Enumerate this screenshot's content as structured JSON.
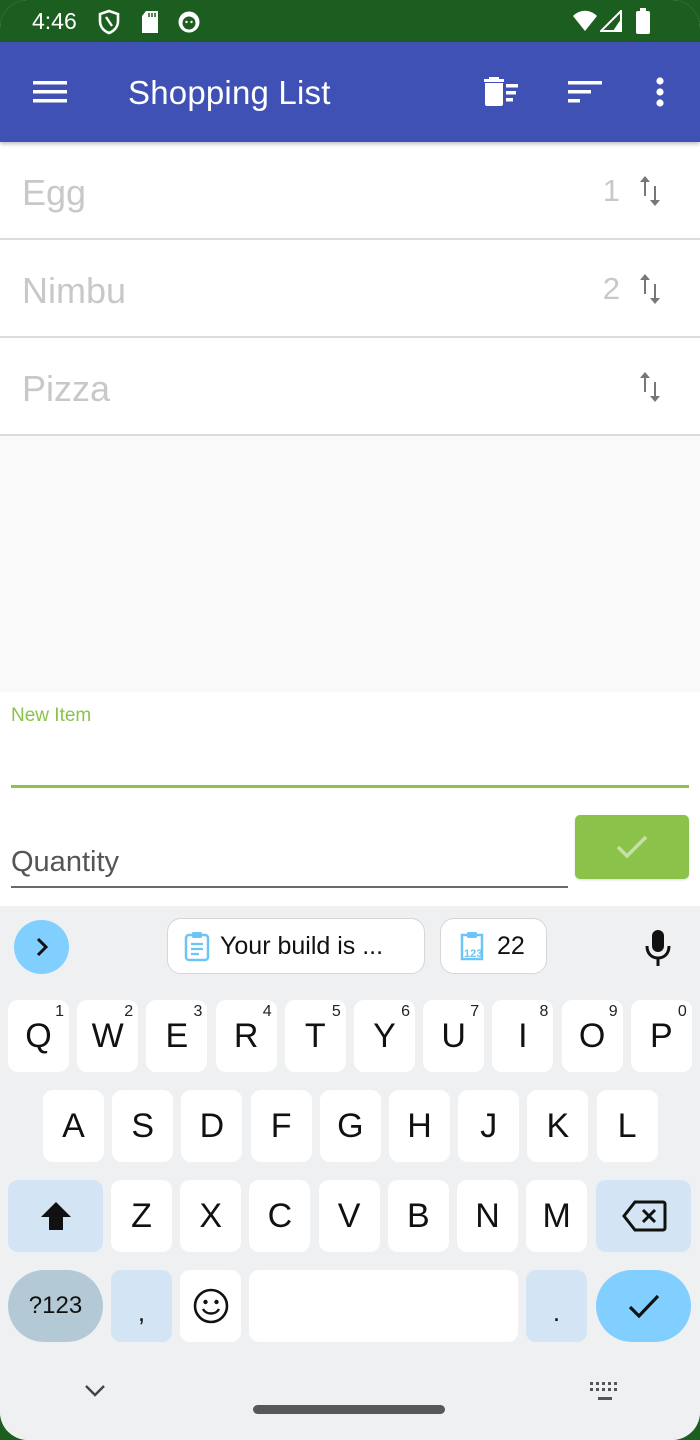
{
  "status_bar": {
    "time": "4:46",
    "left_icons": [
      "shield-icon",
      "sd-card-icon",
      "cat-face-icon"
    ],
    "right_icons": [
      "wifi-icon",
      "cell-signal-icon",
      "battery-icon"
    ]
  },
  "app_bar": {
    "title": "Shopping List",
    "menu_icon": "hamburger-menu-icon",
    "actions": [
      "delete-checked-icon",
      "sort-icon",
      "more-options-icon"
    ],
    "color": "#3f51b5"
  },
  "list": {
    "items": [
      {
        "name": "Egg",
        "quantity": "1"
      },
      {
        "name": "Nimbu",
        "quantity": "2"
      },
      {
        "name": "Pizza",
        "quantity": ""
      }
    ]
  },
  "entry": {
    "new_item_label": "New Item",
    "new_item_value": "",
    "quantity_placeholder": "Quantity",
    "quantity_value": "",
    "accent_color": "#8bc34a"
  },
  "keyboard": {
    "suggestions": [
      {
        "icon": "clipboard-icon",
        "text": "Your build is ..."
      },
      {
        "icon": "clipboard-number-icon",
        "text": "22"
      }
    ],
    "row1": [
      {
        "key": "Q",
        "hint": "1"
      },
      {
        "key": "W",
        "hint": "2"
      },
      {
        "key": "E",
        "hint": "3"
      },
      {
        "key": "R",
        "hint": "4"
      },
      {
        "key": "T",
        "hint": "5"
      },
      {
        "key": "Y",
        "hint": "6"
      },
      {
        "key": "U",
        "hint": "7"
      },
      {
        "key": "I",
        "hint": "8"
      },
      {
        "key": "O",
        "hint": "9"
      },
      {
        "key": "P",
        "hint": "0"
      }
    ],
    "row2": [
      "A",
      "S",
      "D",
      "F",
      "G",
      "H",
      "J",
      "K",
      "L"
    ],
    "row3": [
      "Z",
      "X",
      "C",
      "V",
      "B",
      "N",
      "M"
    ],
    "symbols_label": "?123",
    "comma_label": ",",
    "period_label": "."
  }
}
